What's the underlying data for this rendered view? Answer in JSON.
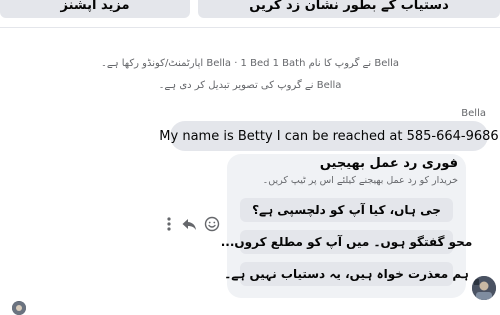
{
  "toolbar": {
    "more_options_label": "مزید آپشنز",
    "mark_unavailable_label": "دستیاب کے بطور نشان زد کریں"
  },
  "system_messages": [
    "Bella نے گروپ کا نام Bella · 1 Bed 1 Bath اپارٹمنٹ/کونڈو رکھا ہے۔",
    "Bella نے گروپ کی تصویر تبدیل کر دی ہے۔"
  ],
  "message": {
    "sender": "Bella",
    "text": "My name is Betty I can be reached at 585-664-9686"
  },
  "quick_replies": {
    "title": "فوری رد عمل بھیجیں",
    "subtitle": "خریدار کو رد عمل بھیجنے کیلئے اس پر ٹیپ کریں۔",
    "options": [
      "جی ہاں، کیا آپ کو دلچسپی ہے؟",
      "محو گفتگو ہوں۔ میں آپ کو مطلع کروں...",
      "ہم معذرت خواہ ہیں، یہ دستیاب نہیں ہے۔"
    ]
  },
  "icons": {
    "more": "more-vertical-icon",
    "reply": "reply-arrow-icon",
    "emoji": "emoji-icon"
  },
  "colors": {
    "bubble": "#e4e6eb",
    "panel": "#f0f2f5",
    "secondary_text": "#65676b"
  }
}
